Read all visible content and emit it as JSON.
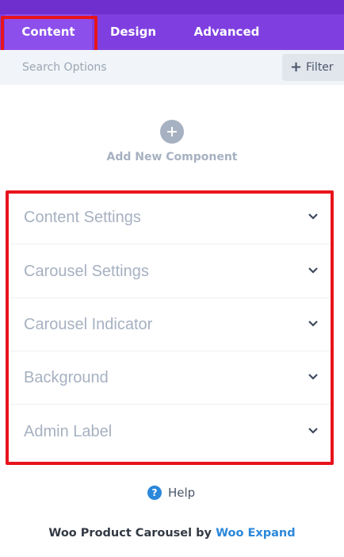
{
  "tabs": [
    {
      "label": "Content",
      "active": true
    },
    {
      "label": "Design",
      "active": false
    },
    {
      "label": "Advanced",
      "active": false
    }
  ],
  "search": {
    "placeholder": "Search Options",
    "value": ""
  },
  "filter": {
    "label": "Filter",
    "icon": "plus-icon"
  },
  "add_component": {
    "label": "Add New Component",
    "icon": "plus-icon"
  },
  "toggles": [
    {
      "label": "Content Settings"
    },
    {
      "label": "Carousel Settings"
    },
    {
      "label": "Carousel Indicator"
    },
    {
      "label": "Background"
    },
    {
      "label": "Admin Label"
    }
  ],
  "help": {
    "label": "Help",
    "icon": "question-icon"
  },
  "footer": {
    "prefix": "Woo Product Carousel by",
    "link": "Woo Expand"
  },
  "colors": {
    "tab_bar": "#7f3fe0",
    "accent_blue": "#2b87da",
    "highlight": "#e8141c"
  }
}
